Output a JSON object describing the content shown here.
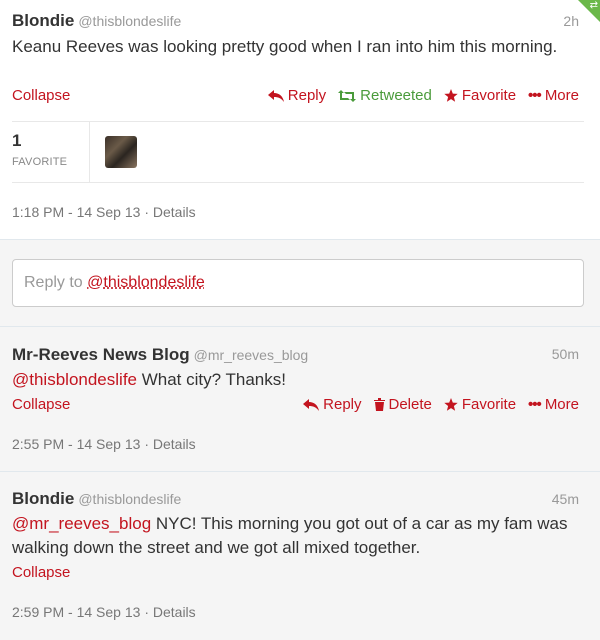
{
  "main_tweet": {
    "name": "Blondie",
    "handle": "@thisblondeslife",
    "time_ago": "2h",
    "text": "Keanu Reeves was looking pretty good when I ran into him this morning.",
    "collapse": "Collapse",
    "actions": {
      "reply": "Reply",
      "retweeted": "Retweeted",
      "favorite": "Favorite",
      "more": "More"
    },
    "stats": {
      "count": "1",
      "label": "FAVORITE"
    },
    "timestamp": "1:18 PM - 14 Sep 13",
    "details": "Details"
  },
  "reply_box": {
    "prefix": "Reply to",
    "mention": "@thisblondeslife"
  },
  "replies": [
    {
      "name": "Mr-Reeves News Blog",
      "handle": "@mr_reeves_blog",
      "time_ago": "50m",
      "mention": "@thisblondeslife",
      "text": " What city? Thanks!",
      "collapse": "Collapse",
      "actions": {
        "reply": "Reply",
        "delete": "Delete",
        "favorite": "Favorite",
        "more": "More"
      },
      "timestamp": "2:55 PM - 14 Sep 13",
      "details": "Details"
    },
    {
      "name": "Blondie",
      "handle": "@thisblondeslife",
      "time_ago": "45m",
      "mention": "@mr_reeves_blog",
      "text": " NYC! This morning you got out of a car as my fam was walking down the street and we got all mixed together.",
      "collapse": "Collapse",
      "timestamp": "2:59 PM - 14 Sep 13",
      "details": "Details"
    }
  ],
  "colors": {
    "accent_red": "#c3141f",
    "retweet_green": "#4a9b3b",
    "corner_green": "#6bb84a"
  },
  "icons": {
    "reply": "reply-arrow-icon",
    "retweet": "retweet-icon",
    "favorite": "star-icon",
    "more": "ellipsis-icon",
    "delete": "trash-icon"
  }
}
